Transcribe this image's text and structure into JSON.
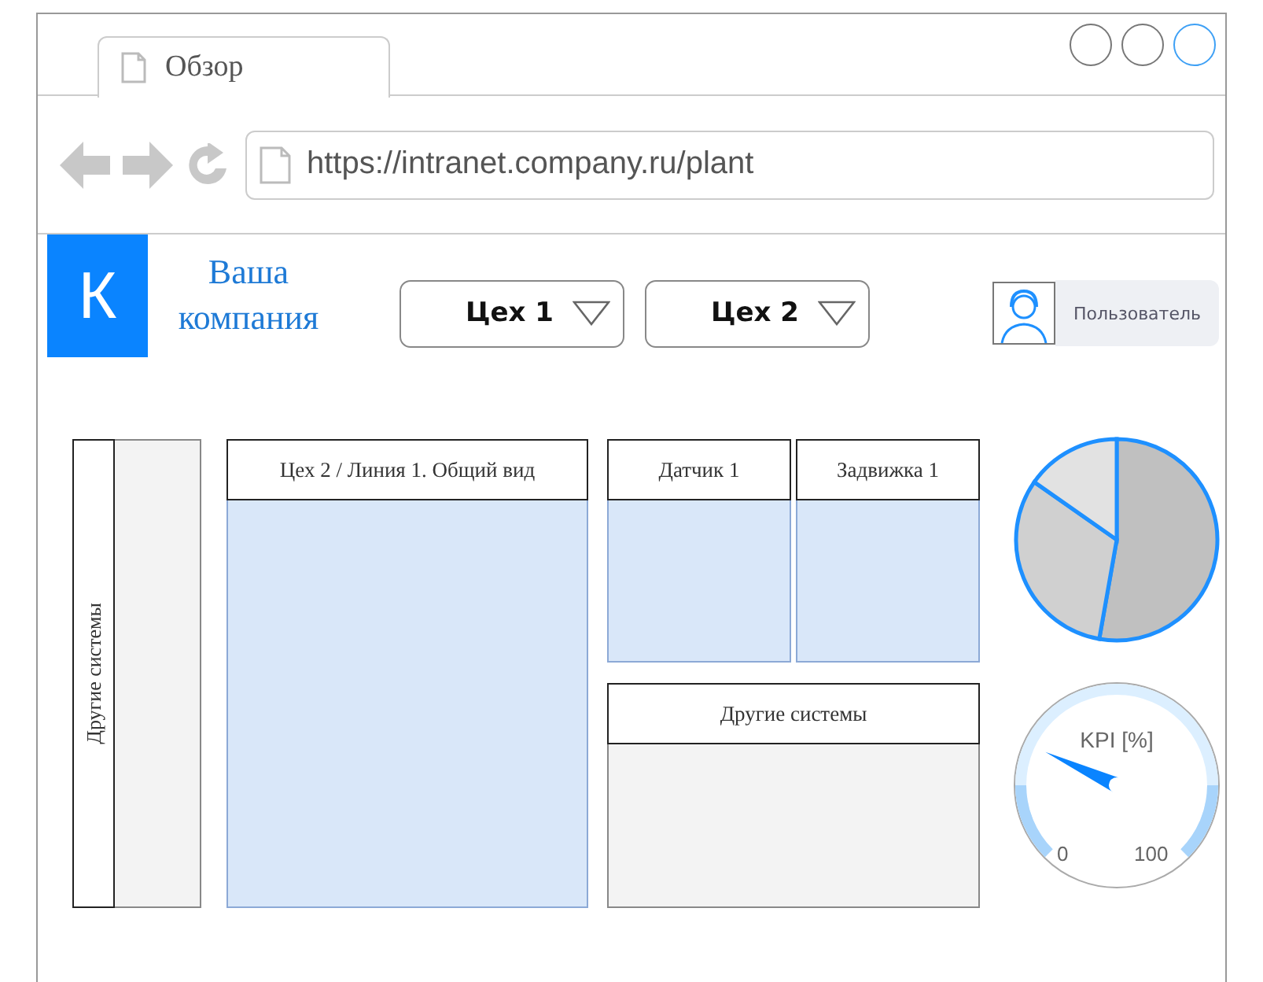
{
  "tab": {
    "title": "Обзор"
  },
  "address_bar": {
    "url": "https://intranet.company.ru/plant"
  },
  "logo": {
    "letter": "К",
    "name": "Ваша компания"
  },
  "dropdowns": [
    {
      "label": "Цех 1"
    },
    {
      "label": "Цех 2"
    }
  ],
  "user": {
    "label": "Пользователь"
  },
  "sidebar": {
    "title": "Другие системы"
  },
  "main_panel": {
    "title": "Цех 2 / Линия 1. Общий вид"
  },
  "small_panels": [
    {
      "title": "Датчик 1"
    },
    {
      "title": "Задвижка 1"
    }
  ],
  "other_panel": {
    "title": "Другие системы"
  },
  "gauge": {
    "title": "KPI [%]",
    "min_label": "0",
    "max_label": "100"
  }
}
